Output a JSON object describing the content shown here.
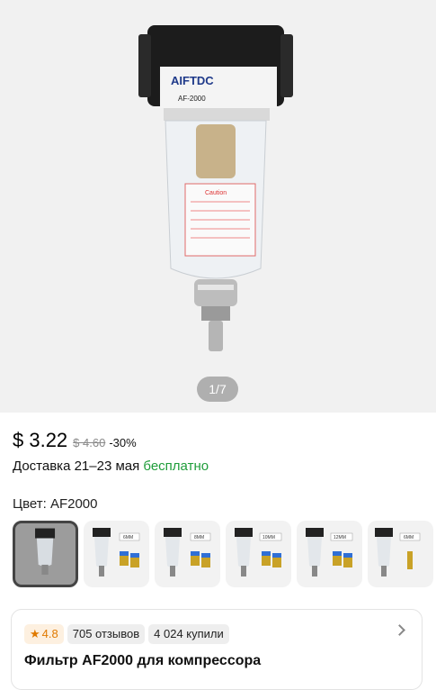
{
  "gallery": {
    "pager": "1/7",
    "product": {
      "brand": "AIFTDC",
      "model": "AF-2000",
      "caution_title": "Caution"
    }
  },
  "pricing": {
    "price": "$ 3.22",
    "old_price": "$ 4.60",
    "discount": "-30%"
  },
  "delivery": {
    "text": "Доставка 21–23 мая",
    "free": "бесплатно"
  },
  "color": {
    "label": "Цвет: AF2000",
    "variants": [
      {
        "tag": "",
        "selected": true
      },
      {
        "tag": "6MM"
      },
      {
        "tag": "8MM"
      },
      {
        "tag": "10MM"
      },
      {
        "tag": "12MM"
      },
      {
        "tag": "6MM"
      }
    ]
  },
  "reviews_card": {
    "rating": "4.8",
    "reviews": "705 отзывов",
    "bought": "4 024 купили",
    "title": "Фильтр AF2000 для компрессора"
  },
  "colors": {
    "free_delivery": "#1f9d3a",
    "rating": "#e07a00"
  }
}
